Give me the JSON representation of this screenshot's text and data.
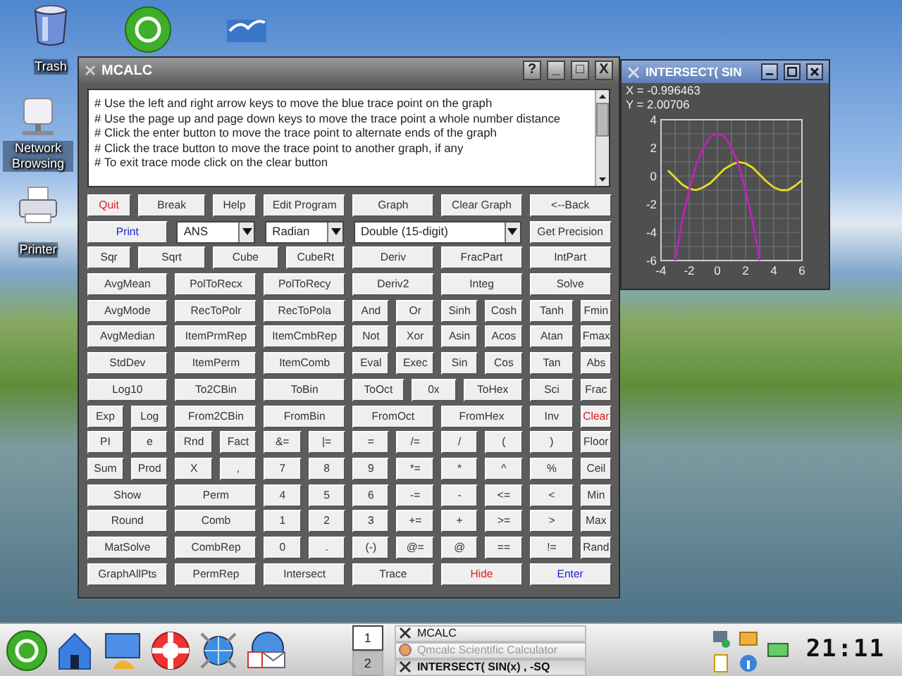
{
  "desktop_icons": [
    {
      "kind": "trash",
      "label": "Trash"
    },
    {
      "kind": "network",
      "label": "Network Browsing"
    },
    {
      "kind": "printer",
      "label": "Printer"
    }
  ],
  "calc_window": {
    "title": "MCALC",
    "title_buttons": [
      "?",
      "_",
      "□",
      "X"
    ],
    "help_text": [
      "# Use the left and right arrow keys to move the blue trace point on the graph",
      "# Use the page up and page down keys to move the trace point a whole number distance",
      "# Click the enter button to move the trace point to alternate ends of the graph",
      "# Click the trace button to move the trace point to another graph, if any",
      "# To exit trace mode click on the clear button"
    ],
    "rows": [
      {
        "buttons": [
          {
            "kind": "button",
            "label": "Quit",
            "color": "#e02020"
          },
          {
            "kind": "button",
            "label": "Break"
          },
          {
            "kind": "button",
            "label": "Help"
          },
          {
            "kind": "button",
            "label": "Edit Program"
          },
          {
            "kind": "button",
            "label": "Graph"
          },
          {
            "kind": "button",
            "label": "Clear Graph"
          },
          {
            "kind": "button",
            "label": "<--Back"
          }
        ]
      },
      {
        "buttons": [
          {
            "kind": "button",
            "label": "Print",
            "color": "#2020e0"
          },
          {
            "kind": "combo",
            "label": "ANS"
          },
          {
            "kind": "combo",
            "label": "Radian"
          },
          {
            "kind": "combo",
            "label": "Double (15-digit)"
          },
          {
            "kind": "button",
            "label": "Get Precision"
          }
        ]
      },
      {
        "buttons": [
          {
            "kind": "button",
            "label": "Sqr"
          },
          {
            "kind": "button",
            "label": "Sqrt"
          },
          {
            "kind": "button",
            "label": "Cube"
          },
          {
            "kind": "button",
            "label": "CubeRt"
          },
          {
            "kind": "button",
            "label": "Deriv"
          },
          {
            "kind": "button",
            "label": "FracPart"
          },
          {
            "kind": "button",
            "label": "IntPart"
          }
        ]
      },
      {
        "buttons": [
          {
            "kind": "button",
            "label": "AvgMean"
          },
          {
            "kind": "button",
            "label": "PolToRecx"
          },
          {
            "kind": "button",
            "label": "PolToRecy"
          },
          {
            "kind": "button",
            "label": "Deriv2"
          },
          {
            "kind": "button",
            "label": "Integ"
          },
          {
            "kind": "button",
            "label": "Solve"
          }
        ]
      },
      {
        "buttons": [
          {
            "kind": "button",
            "label": "AvgMode"
          },
          {
            "kind": "button",
            "label": "RecToPolr"
          },
          {
            "kind": "button",
            "label": "RecToPola"
          },
          {
            "kind": "button",
            "label": "And"
          },
          {
            "kind": "button",
            "label": "Or"
          },
          {
            "kind": "button",
            "label": "Sinh"
          },
          {
            "kind": "button",
            "label": "Cosh"
          },
          {
            "kind": "button",
            "label": "Tanh"
          },
          {
            "kind": "button",
            "label": "Fmin"
          }
        ]
      },
      {
        "buttons": [
          {
            "kind": "button",
            "label": "AvgMedian"
          },
          {
            "kind": "button",
            "label": "ItemPrmRep"
          },
          {
            "kind": "button",
            "label": "ItemCmbRep"
          },
          {
            "kind": "button",
            "label": "Not"
          },
          {
            "kind": "button",
            "label": "Xor"
          },
          {
            "kind": "button",
            "label": "Asin"
          },
          {
            "kind": "button",
            "label": "Acos"
          },
          {
            "kind": "button",
            "label": "Atan"
          },
          {
            "kind": "button",
            "label": "Fmax"
          }
        ]
      },
      {
        "buttons": [
          {
            "kind": "button",
            "label": "StdDev"
          },
          {
            "kind": "button",
            "label": "ItemPerm"
          },
          {
            "kind": "button",
            "label": "ItemComb"
          },
          {
            "kind": "button",
            "label": "Eval"
          },
          {
            "kind": "button",
            "label": "Exec"
          },
          {
            "kind": "button",
            "label": "Sin"
          },
          {
            "kind": "button",
            "label": "Cos"
          },
          {
            "kind": "button",
            "label": "Tan"
          },
          {
            "kind": "button",
            "label": "Abs"
          }
        ]
      },
      {
        "buttons": [
          {
            "kind": "button",
            "label": "Log10"
          },
          {
            "kind": "button",
            "label": "To2CBin"
          },
          {
            "kind": "button",
            "label": "ToBin"
          },
          {
            "kind": "button",
            "label": "ToOct"
          },
          {
            "kind": "button",
            "label": "0x"
          },
          {
            "kind": "button",
            "label": "ToHex"
          },
          {
            "kind": "button",
            "label": "Sci"
          },
          {
            "kind": "button",
            "label": "Frac"
          }
        ]
      },
      {
        "buttons": [
          {
            "kind": "button",
            "label": "Exp"
          },
          {
            "kind": "button",
            "label": "Log"
          },
          {
            "kind": "button",
            "label": "From2CBin"
          },
          {
            "kind": "button",
            "label": "FromBin"
          },
          {
            "kind": "button",
            "label": "FromOct"
          },
          {
            "kind": "button",
            "label": "FromHex"
          },
          {
            "kind": "button",
            "label": "Inv"
          },
          {
            "kind": "button",
            "label": "Clear",
            "color": "#e02020"
          }
        ]
      },
      {
        "buttons": [
          {
            "kind": "button",
            "label": "PI"
          },
          {
            "kind": "button",
            "label": "e"
          },
          {
            "kind": "button",
            "label": "Rnd"
          },
          {
            "kind": "button",
            "label": "Fact"
          },
          {
            "kind": "button",
            "label": "&="
          },
          {
            "kind": "button",
            "label": "|="
          },
          {
            "kind": "button",
            "label": "="
          },
          {
            "kind": "button",
            "label": "/="
          },
          {
            "kind": "button",
            "label": "/"
          },
          {
            "kind": "button",
            "label": "("
          },
          {
            "kind": "button",
            "label": ")"
          },
          {
            "kind": "button",
            "label": "Floor"
          }
        ]
      },
      {
        "buttons": [
          {
            "kind": "button",
            "label": "Sum"
          },
          {
            "kind": "button",
            "label": "Prod"
          },
          {
            "kind": "button",
            "label": "X"
          },
          {
            "kind": "button",
            "label": ","
          },
          {
            "kind": "button",
            "label": "7"
          },
          {
            "kind": "button",
            "label": "8"
          },
          {
            "kind": "button",
            "label": "9"
          },
          {
            "kind": "button",
            "label": "*="
          },
          {
            "kind": "button",
            "label": "*"
          },
          {
            "kind": "button",
            "label": "^"
          },
          {
            "kind": "button",
            "label": "%"
          },
          {
            "kind": "button",
            "label": "Ceil"
          }
        ]
      },
      {
        "buttons": [
          {
            "kind": "button",
            "label": "Show"
          },
          {
            "kind": "button",
            "label": "Perm"
          },
          {
            "kind": "button",
            "label": "4"
          },
          {
            "kind": "button",
            "label": "5"
          },
          {
            "kind": "button",
            "label": "6"
          },
          {
            "kind": "button",
            "label": "-="
          },
          {
            "kind": "button",
            "label": "-"
          },
          {
            "kind": "button",
            "label": "<="
          },
          {
            "kind": "button",
            "label": "<"
          },
          {
            "kind": "button",
            "label": "Min"
          }
        ]
      },
      {
        "buttons": [
          {
            "kind": "button",
            "label": "Round"
          },
          {
            "kind": "button",
            "label": "Comb"
          },
          {
            "kind": "button",
            "label": "1"
          },
          {
            "kind": "button",
            "label": "2"
          },
          {
            "kind": "button",
            "label": "3"
          },
          {
            "kind": "button",
            "label": "+="
          },
          {
            "kind": "button",
            "label": "+"
          },
          {
            "kind": "button",
            "label": ">="
          },
          {
            "kind": "button",
            "label": ">"
          },
          {
            "kind": "button",
            "label": "Max"
          }
        ]
      },
      {
        "buttons": [
          {
            "kind": "button",
            "label": "MatSolve"
          },
          {
            "kind": "button",
            "label": "CombRep"
          },
          {
            "kind": "button",
            "label": "0"
          },
          {
            "kind": "button",
            "label": "."
          },
          {
            "kind": "button",
            "label": "(-)"
          },
          {
            "kind": "button",
            "label": "@="
          },
          {
            "kind": "button",
            "label": "@"
          },
          {
            "kind": "button",
            "label": "=="
          },
          {
            "kind": "button",
            "label": "!="
          },
          {
            "kind": "button",
            "label": "Rand"
          }
        ]
      },
      {
        "buttons": [
          {
            "kind": "button",
            "label": "GraphAllPts"
          },
          {
            "kind": "button",
            "label": "PermRep"
          },
          {
            "kind": "button",
            "label": "Intersect"
          },
          {
            "kind": "button",
            "label": "Trace"
          },
          {
            "kind": "button",
            "label": "Hide",
            "color": "#e02020"
          },
          {
            "kind": "button",
            "label": "Enter",
            "color": "#2020e0"
          }
        ]
      }
    ]
  },
  "graph_window": {
    "title": "INTERSECT( SIN",
    "readout": [
      "X = -0.996463",
      "Y = 2.00706"
    ],
    "chart_data": {
      "type": "line",
      "x": [
        -3.5,
        -3,
        -2.5,
        -2,
        -1.5,
        -1,
        -0.5,
        0,
        0.5,
        1,
        1.5,
        2,
        2.5,
        3,
        3.5,
        4,
        4.5,
        5,
        5.5,
        6
      ],
      "series": [
        {
          "color": "#e8e020",
          "values": [
            0.4,
            -0.1,
            -0.6,
            -0.9,
            -1,
            -0.8,
            -0.5,
            0,
            0.5,
            0.8,
            1,
            0.9,
            0.6,
            0.1,
            -0.4,
            -0.8,
            -1,
            -1,
            -0.7,
            -0.3
          ]
        },
        {
          "color": "#c020c0",
          "values": [
            null,
            -6,
            -3.2,
            -1,
            0.8,
            2,
            2.8,
            3,
            2.8,
            2,
            0.8,
            -1,
            -3.2,
            -6,
            null,
            null,
            null,
            null,
            null,
            null
          ]
        }
      ],
      "grid": true,
      "xlim": [
        -4,
        6
      ],
      "ylim": [
        -6,
        4
      ],
      "xticks": [
        -4,
        -2,
        0,
        2,
        4,
        6
      ],
      "yticks": [
        -6,
        -4,
        -2,
        0,
        2,
        4
      ]
    }
  },
  "taskbar": {
    "pager": [
      {
        "label": "1",
        "selected": true
      },
      {
        "label": "2",
        "selected": false
      }
    ],
    "tasks": [
      {
        "label": "MCALC",
        "selected": false,
        "minimized": false
      },
      {
        "label": "Qmcalc Scientific Calculator",
        "selected": false,
        "minimized": true
      },
      {
        "label": "INTERSECT( SIN(x) , -SQ",
        "selected": true,
        "minimized": false
      }
    ],
    "clock": "21:11"
  }
}
